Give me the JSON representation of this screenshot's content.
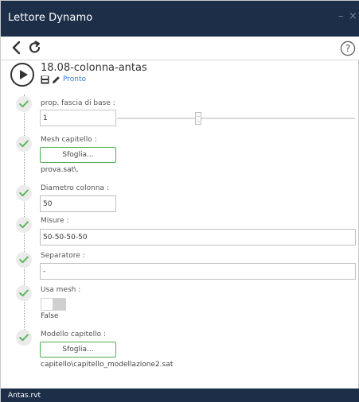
{
  "window": {
    "title": "Lettore Dynamo",
    "minimize_glyph": "–",
    "close_glyph": "×"
  },
  "toolbar": {
    "back_icon": "chevron-left-icon",
    "refresh_icon": "refresh-icon",
    "help_icon": "question-icon",
    "help_glyph": "?"
  },
  "script": {
    "name": "18.08-colonna-antas",
    "status": "Pronto"
  },
  "inputs": [
    {
      "label": "prop. fascia di base :",
      "value": "1",
      "slider_fraction": 0.33
    },
    {
      "label": "Mesh capitello :",
      "button_label": "Sfoglia...",
      "path": "prova.sat\\."
    },
    {
      "label": "Diametro colonna :",
      "value": "50"
    },
    {
      "label": "Misure :",
      "value": "50-50-50-50"
    },
    {
      "label": "Separatore :",
      "value": "-"
    },
    {
      "label": "Usa mesh :",
      "toggle": false,
      "state_text": "False"
    },
    {
      "label": "Modello capitello :",
      "button_label": "Sfoglia...",
      "path": "capitello\\capitello_modellazione2.sat"
    }
  ],
  "footer": {
    "document": "Antas.rvt"
  },
  "colors": {
    "titlebar": "#1d2f48",
    "check_green": "#5cb85c",
    "status_blue": "#2f7fd0",
    "button_border": "#4fae4f"
  }
}
